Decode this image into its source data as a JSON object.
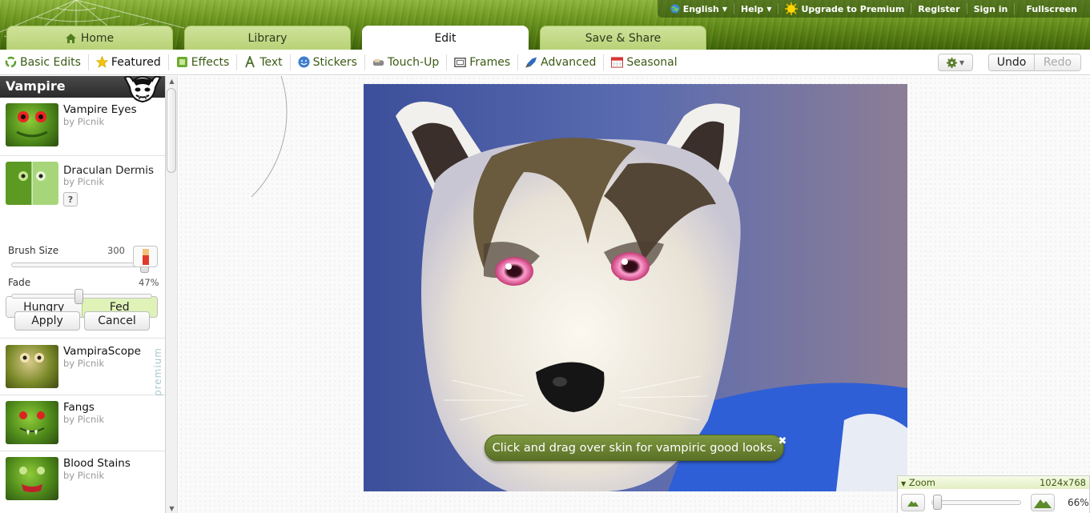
{
  "header": {
    "links": [
      {
        "label": "English",
        "icon": "globe-icon",
        "has_menu": true
      },
      {
        "label": "Help",
        "has_menu": true
      },
      {
        "label": "Upgrade to Premium",
        "icon": "sun-icon"
      },
      {
        "label": "Register"
      },
      {
        "label": "Sign in"
      },
      {
        "label": "Fullscreen"
      }
    ],
    "tabs": [
      {
        "label": "Home",
        "icon": "home-icon"
      },
      {
        "label": "Library"
      },
      {
        "label": "Edit",
        "active": true
      },
      {
        "label": "Save & Share"
      }
    ]
  },
  "toolbar": {
    "tools": [
      {
        "label": "Basic Edits",
        "icon": "recycle-icon"
      },
      {
        "label": "Featured",
        "icon": "star-icon",
        "selected": true
      },
      {
        "label": "Effects",
        "icon": "effects-icon"
      },
      {
        "label": "Text",
        "icon": "text-icon"
      },
      {
        "label": "Stickers",
        "icon": "sticker-smiley-icon"
      },
      {
        "label": "Touch-Up",
        "icon": "touchup-icon"
      },
      {
        "label": "Frames",
        "icon": "frames-icon"
      },
      {
        "label": "Advanced",
        "icon": "rocket-icon"
      },
      {
        "label": "Seasonal",
        "icon": "calendar-icon"
      }
    ],
    "undo": "Undo",
    "redo": "Redo",
    "options_icon": "gear-icon"
  },
  "sidebar": {
    "title": "Vampire",
    "vampire_eyes": {
      "name": "Vampire Eyes",
      "by": "by Picnik"
    },
    "draculan": {
      "name": "Draculan Dermis",
      "by": "by Picnik",
      "help": "?",
      "mode_options": [
        "Hungry",
        "Fed"
      ],
      "mode_selected": "Fed",
      "brush_label": "Brush Size",
      "brush_value": "300",
      "brush_fraction": 0.97,
      "fade_label": "Fade",
      "fade_value": "47%",
      "fade_fraction": 0.47,
      "apply": "Apply",
      "cancel": "Cancel"
    },
    "more_items": [
      {
        "name": "VampiraScope",
        "by": "by Picnik",
        "badge": "premium"
      },
      {
        "name": "Fangs",
        "by": "by Picnik"
      },
      {
        "name": "Blood Stains",
        "by": "by Picnik"
      }
    ]
  },
  "canvas": {
    "tooltip": "Click and drag over skin for vampiric good looks."
  },
  "zoom": {
    "label": "Zoom",
    "dimensions": "1024x768",
    "percent": "66%",
    "fraction": 0.02
  }
}
